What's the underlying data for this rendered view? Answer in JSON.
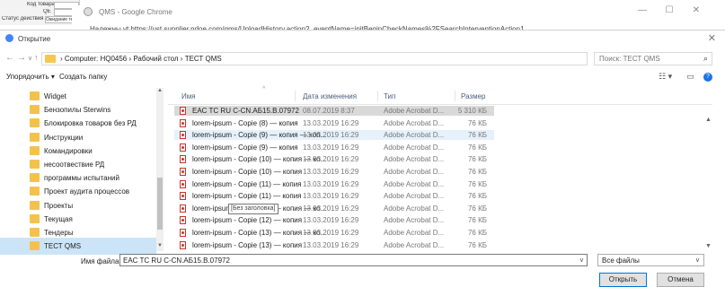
{
  "background": {
    "excel_rows": [
      {
        "label": "Код товара",
        "value": ""
      },
      {
        "label": "QE",
        "value": ""
      },
      {
        "label": "Статус действия",
        "value": "Ожидание те"
      }
    ],
    "chrome_title": "QMS - Google Chrome",
    "chrome_url": "Надежны  vt   https://ust.supplier.ndoe.com/qms/UploadHistory.action?_eventName=initBeginCheckNames%2FSearchInterventionAction1"
  },
  "dialog": {
    "title": "Открытие",
    "address_path": "› Computer: HQ0456 › Рабочий стол › ТЕСТ QMS",
    "search_placeholder": "Поиск: ТЕСТ QMS",
    "toolbar": {
      "organize": "Упорядочить ▾",
      "new_folder": "Создать папку"
    },
    "sidebar": [
      {
        "label": "Widget"
      },
      {
        "label": "Бензопилы Sterwins"
      },
      {
        "label": "Блокировка товаров без РД"
      },
      {
        "label": "Инструкции"
      },
      {
        "label": "Командировки"
      },
      {
        "label": "несоотвествие РД"
      },
      {
        "label": "программы испытаний"
      },
      {
        "label": "Проект аудита процессов"
      },
      {
        "label": "Проекты"
      },
      {
        "label": "Текущая"
      },
      {
        "label": "Тендеры"
      },
      {
        "label": "ТЕСТ QMS",
        "selected": true
      }
    ],
    "columns": {
      "name": "Имя",
      "date": "Дата изменения",
      "type": "Тип",
      "size": "Размер"
    },
    "files": [
      {
        "name": "EAC TC RU C-CN.АБ15.В.07972",
        "date": "08.07.2019 8:37",
        "type": "Adobe Acrobat D...",
        "size": "5 310 КБ",
        "state": "sel"
      },
      {
        "name": "lorem-ipsum - Copie (8) — копия",
        "date": "13.03.2019 16:29",
        "type": "Adobe Acrobat D...",
        "size": "76 КБ"
      },
      {
        "name": "lorem-ipsum - Copie (9) — копия — коп...",
        "date": "13.03.2019 16:29",
        "type": "Adobe Acrobat D...",
        "size": "76 КБ",
        "state": "hover"
      },
      {
        "name": "lorem-ipsum - Copie (9) — копия",
        "date": "13.03.2019 16:29",
        "type": "Adobe Acrobat D...",
        "size": "76 КБ"
      },
      {
        "name": "lorem-ipsum - Copie (10) — копия — ко...",
        "date": "13.03.2019 16:29",
        "type": "Adobe Acrobat D...",
        "size": "76 КБ"
      },
      {
        "name": "lorem-ipsum - Copie (10) — копия",
        "date": "13.03.2019 16:29",
        "type": "Adobe Acrobat D...",
        "size": "76 КБ"
      },
      {
        "name": "lorem-ipsum - Copie (11) — копия",
        "date": "13.03.2019 16:29",
        "type": "Adobe Acrobat D...",
        "size": "76 КБ"
      },
      {
        "name": "lorem-ipsum - Copie (11) — копия",
        "date": "13.03.2019 16:29",
        "type": "Adobe Acrobat D...",
        "size": "76 КБ"
      },
      {
        "name": "lorem-ipsum - Copie (12) — копия — ко...",
        "date": "13.03.2019 16:29",
        "type": "Adobe Acrobat D...",
        "size": "76 КБ"
      },
      {
        "name": "lorem-ipsum - Copie (12) — копия",
        "date": "13.03.2019 16:29",
        "type": "Adobe Acrobat D...",
        "size": "76 КБ"
      },
      {
        "name": "lorem-ipsum - Copie (13) — копия — ко...",
        "date": "13.03.2019 16:29",
        "type": "Adobe Acrobat D...",
        "size": "76 КБ"
      },
      {
        "name": "lorem-ipsum - Copie (13) — копия",
        "date": "13.03.2019 16:29",
        "type": "Adobe Acrobat D...",
        "size": "76 КБ"
      }
    ],
    "tooltip": "[Без заголовка]",
    "filename_label": "Имя файла:",
    "filename_value": "EAC TC RU C-CN.АБ15.В.07972",
    "filter_value": "Все файлы",
    "open_button": "Открыть",
    "cancel_button": "Отмена"
  },
  "colors": {
    "selected_folder": "#cce4f7",
    "selected_file": "#d9d9d9",
    "hover_file": "#e5f1fb",
    "folder": "#f3c24e",
    "pdf": "#c8342a"
  }
}
